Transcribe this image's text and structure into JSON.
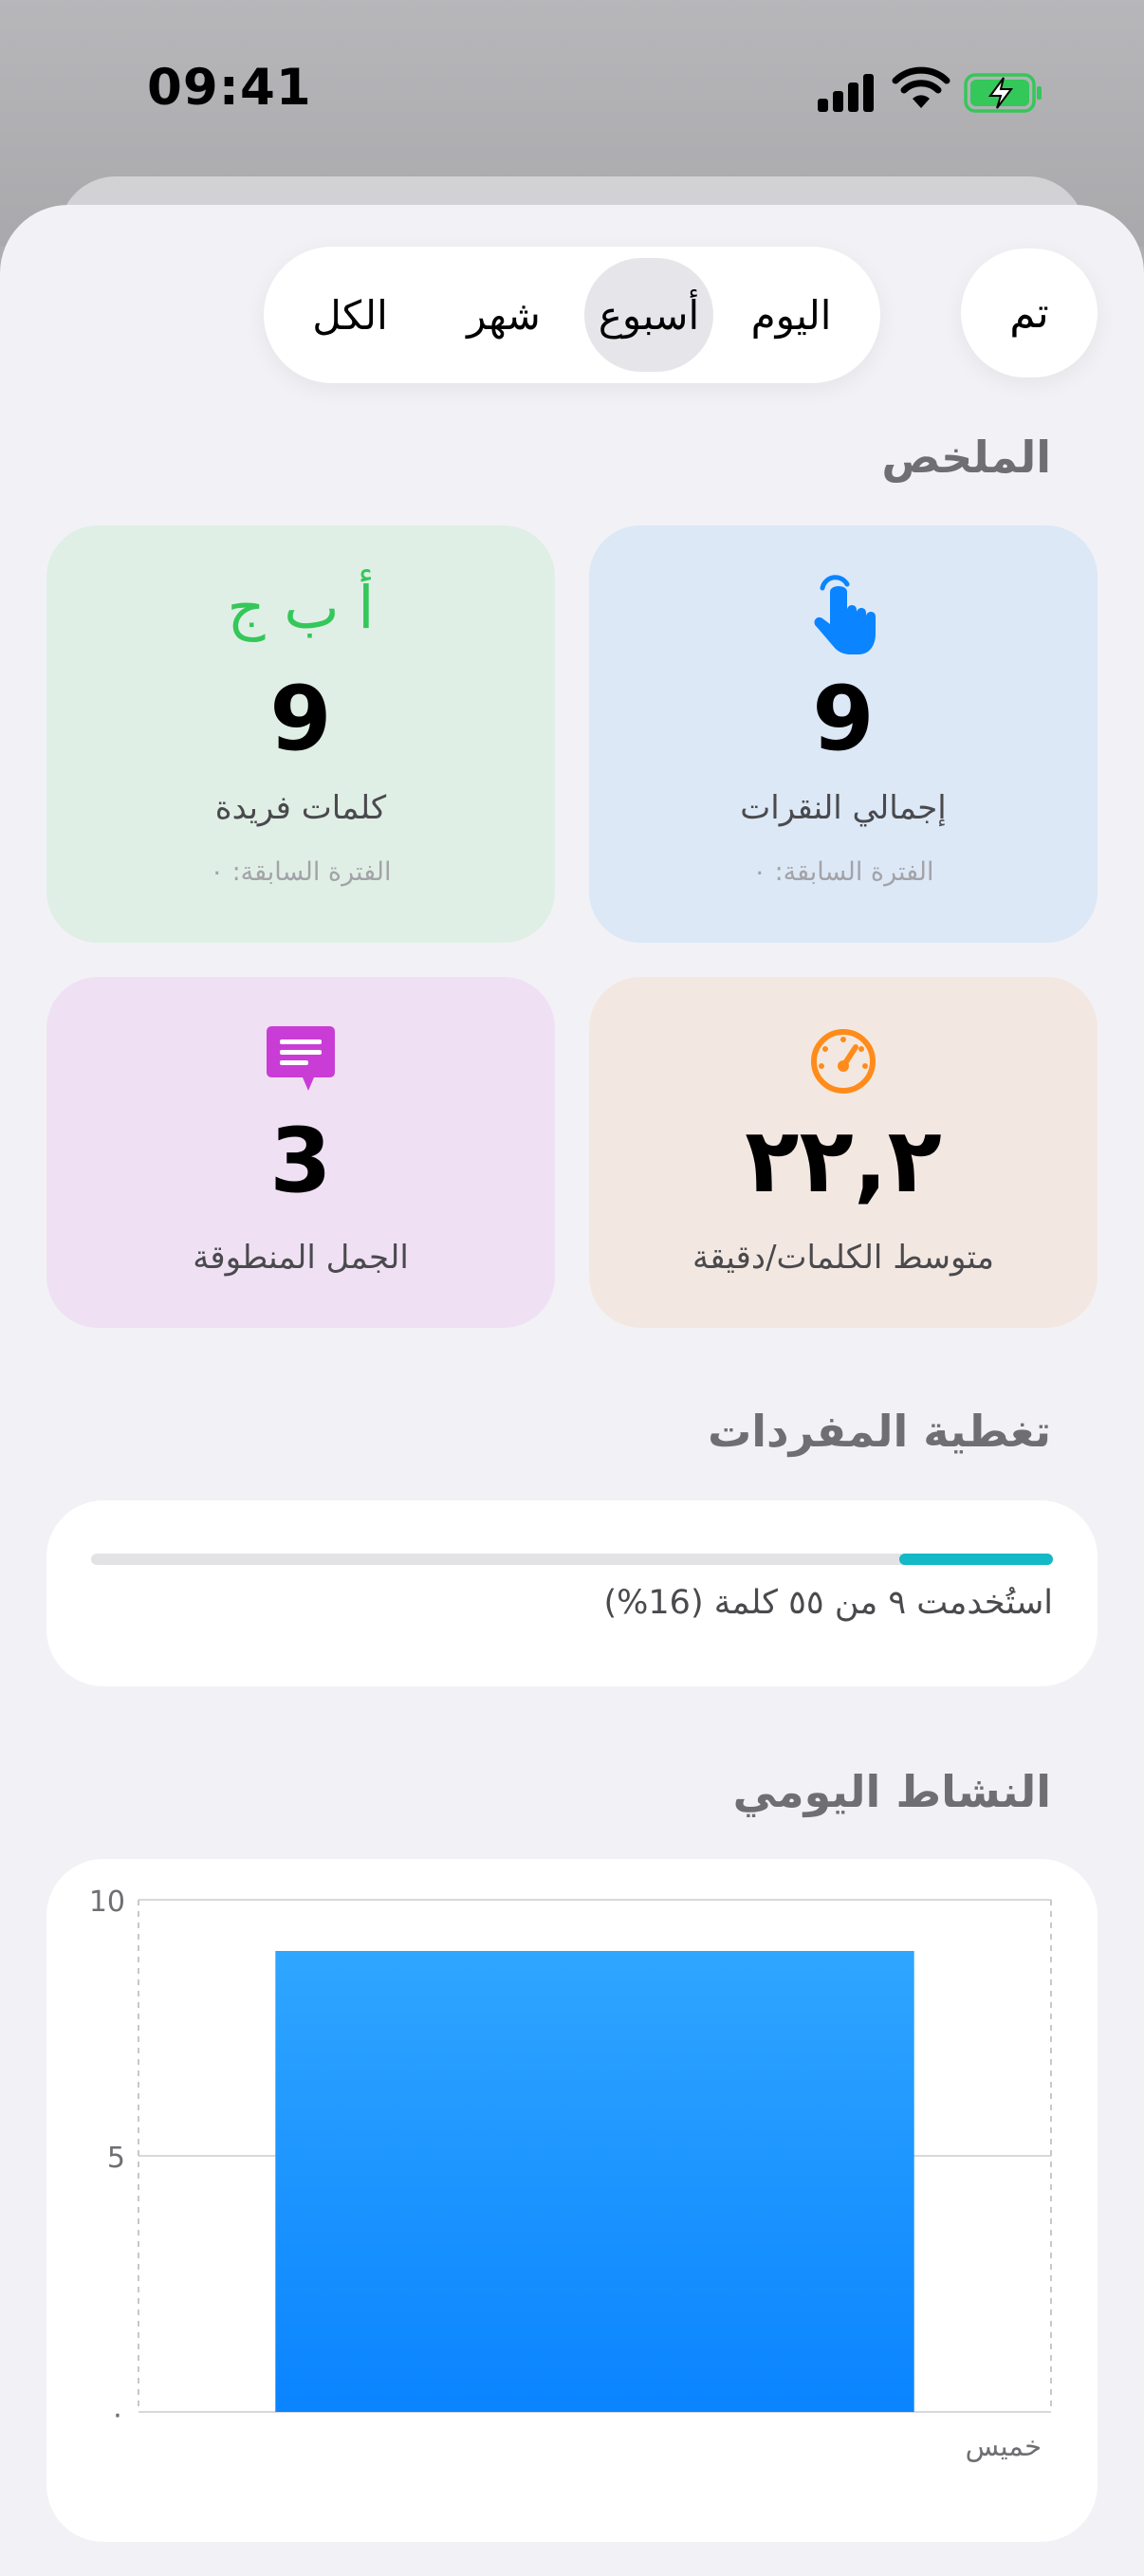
{
  "status_bar": {
    "time": "09:41"
  },
  "header": {
    "done_label": "تم",
    "segments": [
      {
        "label": "اليوم",
        "selected": false
      },
      {
        "label": "أسبوع",
        "selected": true
      },
      {
        "label": "شهر",
        "selected": false
      },
      {
        "label": "الكل",
        "selected": false
      }
    ]
  },
  "summary": {
    "title": "الملخص",
    "cards": {
      "total_taps": {
        "icon": "hand-tap-icon",
        "value": "9",
        "label": "إجمالي النقرات",
        "previous": "الفترة السابقة: ٠",
        "color": "#dce8f6",
        "icon_color": "#0a84ff"
      },
      "unique_words": {
        "icon": "abc-letters-icon",
        "icon_text": "أ ب ج",
        "value": "9",
        "label": "كلمات فريدة",
        "previous": "الفترة السابقة: ٠",
        "color": "#e0efe6",
        "icon_color": "#34c759"
      },
      "avg_wpm": {
        "icon": "speedometer-icon",
        "value": "٢٢,٢",
        "label": "متوسط الكلمات/دقيقة",
        "color": "#f3e8e1",
        "icon_color": "#ff8c1a"
      },
      "spoken_sentences": {
        "icon": "message-bubble-icon",
        "value": "3",
        "label": "الجمل المنطوقة",
        "color": "#efe1f3",
        "icon_color": "#c93dd6"
      }
    }
  },
  "vocabulary": {
    "title": "تغطية المفردات",
    "used_fraction": 0.16,
    "text": "استُخدمت ٩ من ٥٥ كلمة (16%)",
    "color": "#14b8c6"
  },
  "daily_activity": {
    "title": "النشاط اليومي"
  },
  "chart_data": {
    "type": "bar",
    "categories": [
      "خميس"
    ],
    "values": [
      9
    ],
    "ylim": [
      0,
      10
    ],
    "yticks": [
      "10",
      "5",
      "٠"
    ],
    "title": "",
    "xlabel": "",
    "ylabel": "",
    "grid": true,
    "bar_color": "#0a84ff"
  }
}
